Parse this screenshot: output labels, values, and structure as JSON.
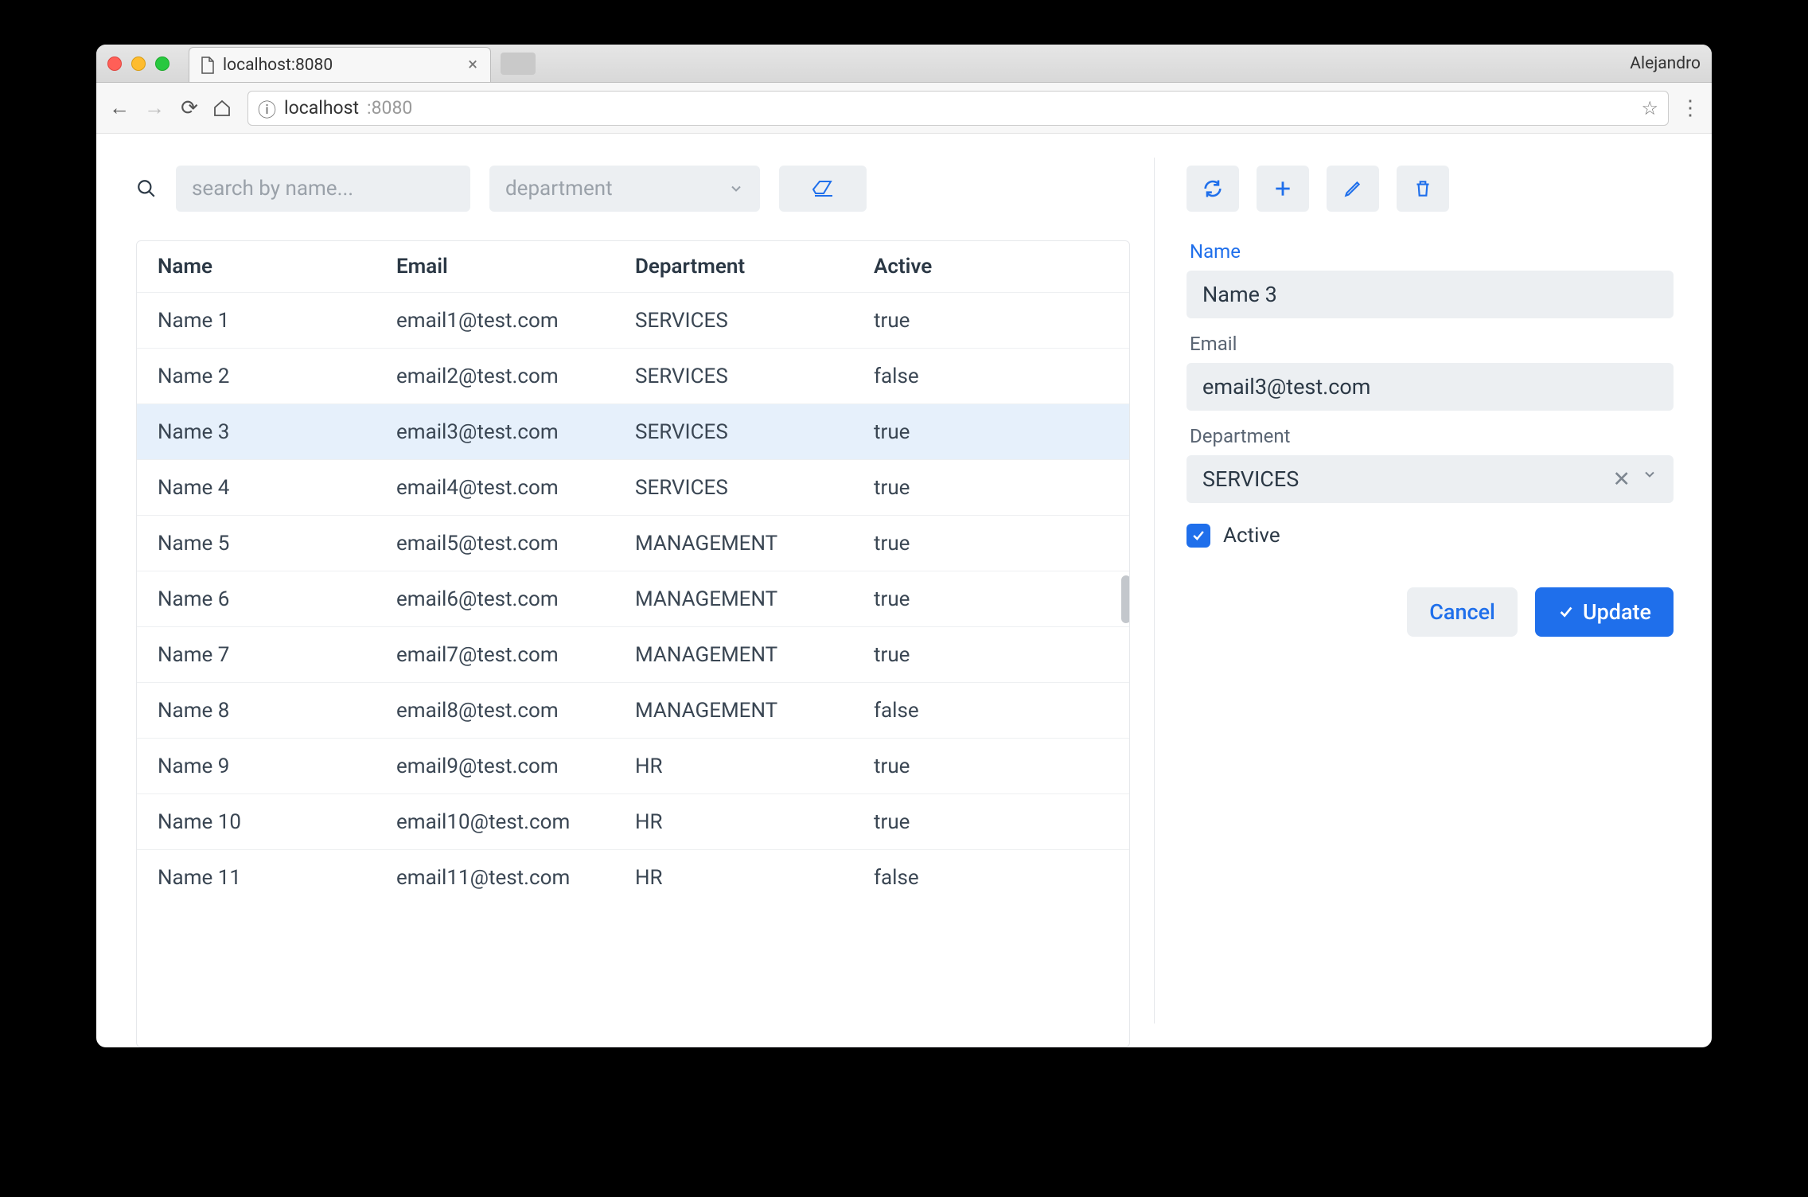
{
  "browser": {
    "tab_title": "localhost:8080",
    "profile": "Alejandro",
    "url_prefix": "localhost",
    "url_suffix": ":8080"
  },
  "filters": {
    "search_placeholder": "search by name...",
    "department_placeholder": "department"
  },
  "table": {
    "headers": {
      "name": "Name",
      "email": "Email",
      "department": "Department",
      "active": "Active"
    },
    "rows": [
      {
        "name": "Name 1",
        "email": "email1@test.com",
        "department": "SERVICES",
        "active": "true"
      },
      {
        "name": "Name 2",
        "email": "email2@test.com",
        "department": "SERVICES",
        "active": "false"
      },
      {
        "name": "Name 3",
        "email": "email3@test.com",
        "department": "SERVICES",
        "active": "true"
      },
      {
        "name": "Name 4",
        "email": "email4@test.com",
        "department": "SERVICES",
        "active": "true"
      },
      {
        "name": "Name 5",
        "email": "email5@test.com",
        "department": "MANAGEMENT",
        "active": "true"
      },
      {
        "name": "Name 6",
        "email": "email6@test.com",
        "department": "MANAGEMENT",
        "active": "true"
      },
      {
        "name": "Name 7",
        "email": "email7@test.com",
        "department": "MANAGEMENT",
        "active": "true"
      },
      {
        "name": "Name 8",
        "email": "email8@test.com",
        "department": "MANAGEMENT",
        "active": "false"
      },
      {
        "name": "Name 9",
        "email": "email9@test.com",
        "department": "HR",
        "active": "true"
      },
      {
        "name": "Name 10",
        "email": "email10@test.com",
        "department": "HR",
        "active": "true"
      },
      {
        "name": "Name 11",
        "email": "email11@test.com",
        "department": "HR",
        "active": "false"
      }
    ],
    "selected_index": 2
  },
  "form": {
    "labels": {
      "name": "Name",
      "email": "Email",
      "department": "Department",
      "active": "Active"
    },
    "values": {
      "name": "Name 3",
      "email": "email3@test.com",
      "department": "SERVICES"
    },
    "buttons": {
      "cancel": "Cancel",
      "update": "Update"
    }
  }
}
